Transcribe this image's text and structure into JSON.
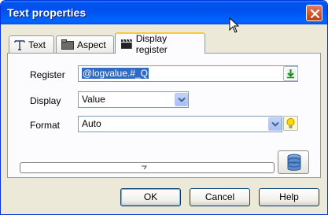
{
  "window": {
    "title": "Text properties"
  },
  "tabs": [
    {
      "label": "Text",
      "icon": "text-t-icon"
    },
    {
      "label": "Aspect",
      "icon": "folder-icon"
    },
    {
      "label": "Display register",
      "icon": "clapper-icon"
    }
  ],
  "form": {
    "register_label": "Register",
    "register_value": "@logvalue.#_Q",
    "display_label": "Display",
    "display_value": "Value",
    "format_label": "Format",
    "format_value": "Auto"
  },
  "buttons": {
    "ok": "OK",
    "cancel": "Cancel",
    "help": "Help"
  },
  "colors": {
    "titlebar": "#0050ee",
    "active_tab_accent": "#ffc83c",
    "selection": "#316ac5"
  }
}
